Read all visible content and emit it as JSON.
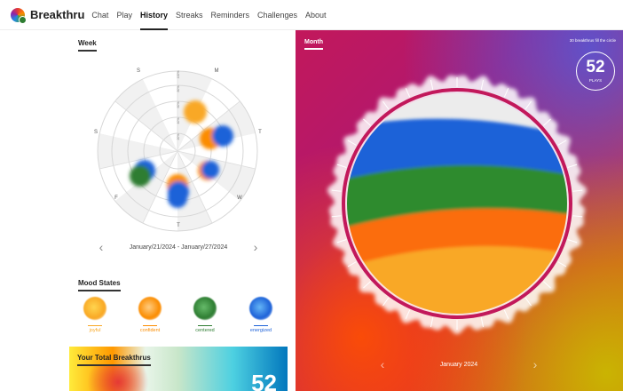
{
  "nav": {
    "brand": "Breakthru",
    "items": [
      "Chat",
      "Play",
      "History",
      "Streaks",
      "Reminders",
      "Challenges",
      "About"
    ],
    "active": "History"
  },
  "week": {
    "title": "Week",
    "day_labels": [
      "M",
      "T",
      "W",
      "T",
      "F",
      "S",
      "S"
    ],
    "ring_labels": [
      "100%",
      "80%",
      "60%",
      "40%",
      "20%"
    ],
    "range": "January/21/2024 - January/27/2024"
  },
  "mood": {
    "title": "Mood States",
    "items": [
      {
        "label": "joyful",
        "color": "#f9a825"
      },
      {
        "label": "confident",
        "color": "#fb8c00"
      },
      {
        "label": "centered",
        "color": "#2e7d32"
      },
      {
        "label": "energized",
        "color": "#1e62d8"
      }
    ]
  },
  "total": {
    "title": "Your Total Breakthrus",
    "value": "52"
  },
  "month": {
    "title": "Month",
    "hint": "30 breakthrus fill the circle",
    "plays_value": "52",
    "plays_label": "PLAYS",
    "label": "January 2024",
    "fill_colors": [
      "#f9a825",
      "#fb6d0c",
      "#2e8b2e",
      "#1e62d8"
    ]
  },
  "colors": {
    "joyful": "#f9a825",
    "confident": "#fb8c00",
    "centered": "#2e7d32",
    "energized": "#1e62d8"
  }
}
